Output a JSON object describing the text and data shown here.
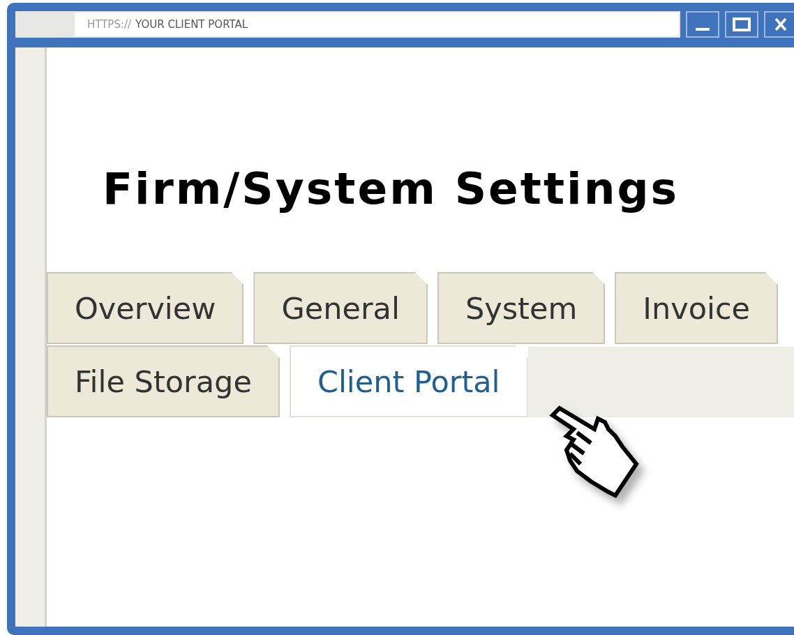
{
  "address_bar": {
    "scheme": "HTTPS://",
    "text": "YOUR CLIENT PORTAL"
  },
  "heading": "Firm/System Settings",
  "tab_rows": [
    {
      "tabs": [
        {
          "label": "Overview",
          "selected": false
        },
        {
          "label": "General",
          "selected": false
        },
        {
          "label": "System",
          "selected": false
        },
        {
          "label": "Invoice",
          "selected": false
        }
      ]
    },
    {
      "tabs": [
        {
          "label": "File Storage",
          "selected": false
        },
        {
          "label": "Client Portal",
          "selected": true
        }
      ]
    }
  ]
}
